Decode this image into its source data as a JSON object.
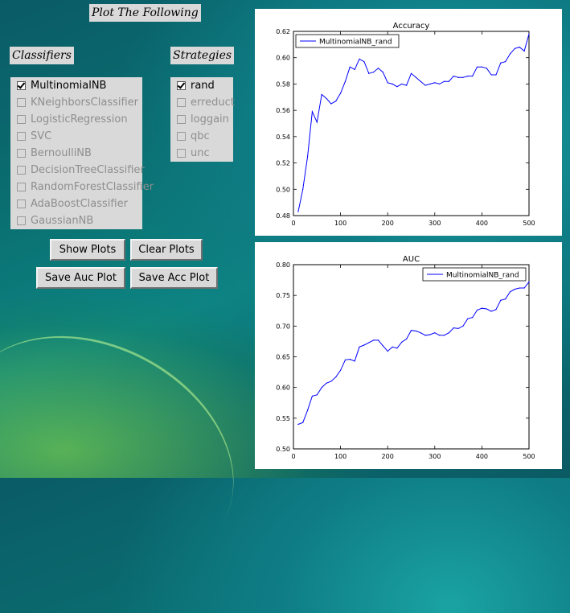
{
  "header": {
    "title": "Plot The Following"
  },
  "classifiers": {
    "title": "Classifiers",
    "items": [
      {
        "label": "MultinomialNB",
        "checked": true,
        "enabled": true
      },
      {
        "label": "KNeighborsClassifier",
        "checked": false,
        "enabled": false
      },
      {
        "label": "LogisticRegression",
        "checked": false,
        "enabled": false
      },
      {
        "label": "SVC",
        "checked": false,
        "enabled": false
      },
      {
        "label": "BernoulliNB",
        "checked": false,
        "enabled": false
      },
      {
        "label": "DecisionTreeClassifier",
        "checked": false,
        "enabled": false
      },
      {
        "label": "RandomForestClassifier",
        "checked": false,
        "enabled": false
      },
      {
        "label": "AdaBoostClassifier",
        "checked": false,
        "enabled": false
      },
      {
        "label": "GaussianNB",
        "checked": false,
        "enabled": false
      }
    ]
  },
  "strategies": {
    "title": "Strategies",
    "items": [
      {
        "label": "rand",
        "checked": true,
        "enabled": true
      },
      {
        "label": "erreduct",
        "checked": false,
        "enabled": false
      },
      {
        "label": "loggain",
        "checked": false,
        "enabled": false
      },
      {
        "label": "qbc",
        "checked": false,
        "enabled": false
      },
      {
        "label": "unc",
        "checked": false,
        "enabled": false
      }
    ]
  },
  "buttons": {
    "show_plots": "Show Plots",
    "clear_plots": "Clear Plots",
    "save_auc": "Save Auc Plot",
    "save_acc": "Save Acc Plot"
  },
  "colors": {
    "series": "#0000ff",
    "panel": "#d9d9d9"
  },
  "chart_data": [
    {
      "type": "line",
      "title": "Accuracy",
      "xlabel": "",
      "ylabel": "",
      "xlim": [
        0,
        500
      ],
      "ylim": [
        0.48,
        0.62
      ],
      "xticks": [
        "0",
        "100",
        "200",
        "300",
        "400",
        "500"
      ],
      "yticks": [
        "0.48",
        "0.50",
        "0.52",
        "0.54",
        "0.56",
        "0.58",
        "0.60",
        "0.62"
      ],
      "legend_position": "upper-left",
      "series": [
        {
          "name": "MultinomialNB_rand",
          "x": [
            10,
            20,
            30,
            40,
            50,
            60,
            70,
            80,
            90,
            100,
            110,
            120,
            130,
            140,
            150,
            160,
            170,
            180,
            190,
            200,
            210,
            220,
            230,
            240,
            250,
            260,
            270,
            280,
            290,
            300,
            310,
            320,
            330,
            340,
            350,
            360,
            370,
            380,
            390,
            400,
            410,
            420,
            430,
            440,
            450,
            460,
            470,
            480,
            490,
            500
          ],
          "values": [
            0.483,
            0.5,
            0.525,
            0.559,
            0.551,
            0.572,
            0.569,
            0.565,
            0.567,
            0.573,
            0.582,
            0.593,
            0.591,
            0.599,
            0.597,
            0.588,
            0.589,
            0.592,
            0.589,
            0.581,
            0.58,
            0.578,
            0.58,
            0.579,
            0.588,
            0.585,
            0.582,
            0.579,
            0.58,
            0.581,
            0.58,
            0.582,
            0.582,
            0.586,
            0.585,
            0.585,
            0.586,
            0.586,
            0.593,
            0.593,
            0.592,
            0.587,
            0.587,
            0.596,
            0.597,
            0.603,
            0.607,
            0.608,
            0.605,
            0.618
          ]
        }
      ]
    },
    {
      "type": "line",
      "title": "AUC",
      "xlabel": "",
      "ylabel": "",
      "xlim": [
        0,
        500
      ],
      "ylim": [
        0.5,
        0.8
      ],
      "xticks": [
        "0",
        "100",
        "200",
        "300",
        "400",
        "500"
      ],
      "yticks": [
        "0.50",
        "0.55",
        "0.60",
        "0.65",
        "0.70",
        "0.75",
        "0.80"
      ],
      "legend_position": "upper-right",
      "series": [
        {
          "name": "MultinomialNB_rand",
          "x": [
            10,
            20,
            30,
            40,
            50,
            60,
            70,
            80,
            90,
            100,
            110,
            120,
            130,
            140,
            150,
            160,
            170,
            180,
            190,
            200,
            210,
            220,
            230,
            240,
            250,
            260,
            270,
            280,
            290,
            300,
            310,
            320,
            330,
            340,
            350,
            360,
            370,
            380,
            390,
            400,
            410,
            420,
            430,
            440,
            450,
            460,
            470,
            480,
            490,
            500
          ],
          "values": [
            0.54,
            0.543,
            0.563,
            0.586,
            0.588,
            0.6,
            0.607,
            0.61,
            0.617,
            0.628,
            0.645,
            0.646,
            0.643,
            0.666,
            0.669,
            0.673,
            0.677,
            0.677,
            0.668,
            0.659,
            0.666,
            0.664,
            0.674,
            0.679,
            0.693,
            0.692,
            0.689,
            0.685,
            0.686,
            0.689,
            0.685,
            0.685,
            0.689,
            0.697,
            0.696,
            0.7,
            0.712,
            0.714,
            0.726,
            0.729,
            0.728,
            0.724,
            0.727,
            0.742,
            0.744,
            0.756,
            0.76,
            0.762,
            0.762,
            0.772
          ]
        }
      ]
    }
  ]
}
